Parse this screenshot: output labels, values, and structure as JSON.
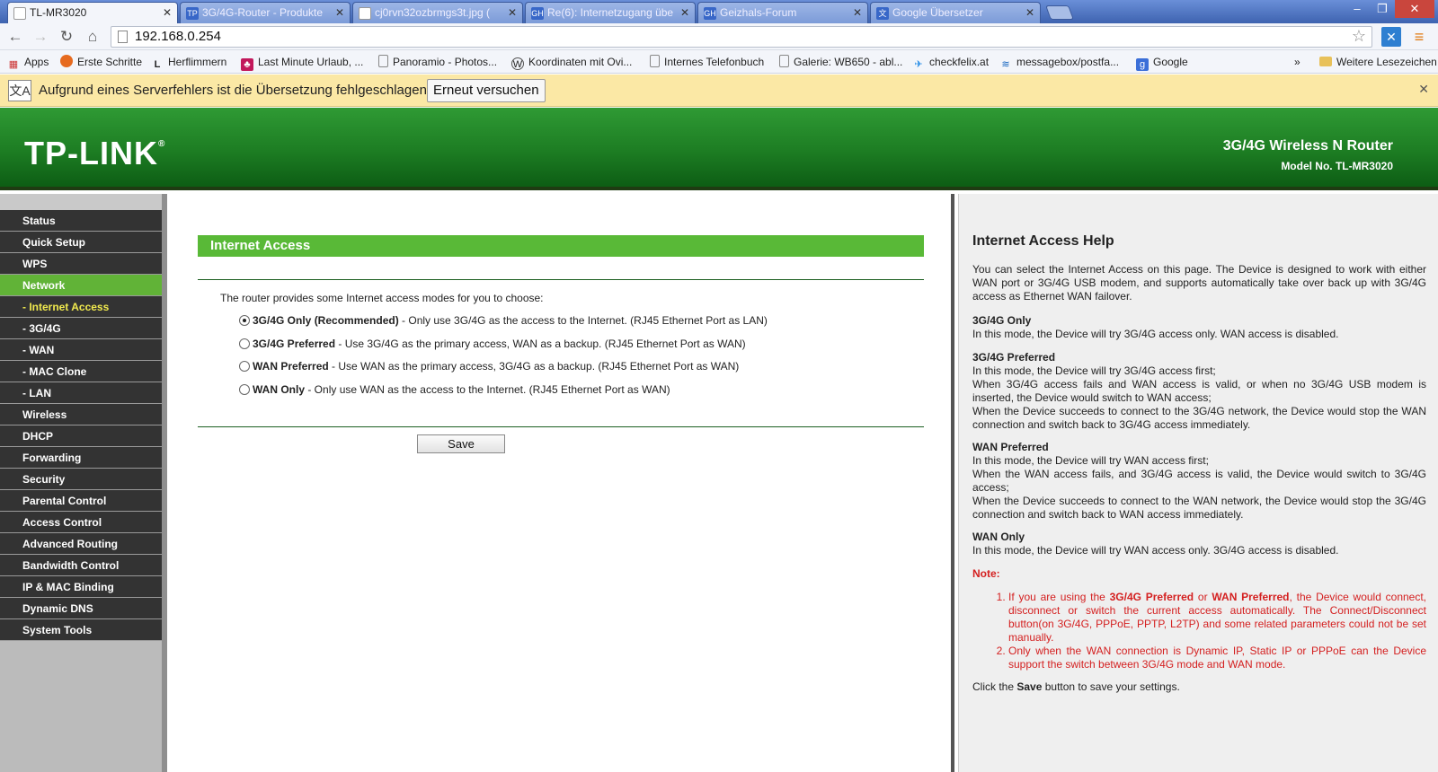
{
  "browser": {
    "tabs": [
      {
        "title": "TL-MR3020",
        "icon": "page-icon",
        "active": true
      },
      {
        "title": "3G/4G-Router - Produkte",
        "icon": "tplink-icon",
        "active": false
      },
      {
        "title": "cj0rvn32ozbrmgs3t.jpg (",
        "icon": "page-icon",
        "active": false
      },
      {
        "title": "Re(6): Internetzugang übe",
        "icon": "geizhals-icon",
        "active": false
      },
      {
        "title": "Geizhals-Forum",
        "icon": "geizhals-icon",
        "active": false
      },
      {
        "title": "Google Übersetzer",
        "icon": "translate-icon",
        "active": false
      }
    ],
    "url": "192.168.0.254",
    "bookmarks": [
      {
        "label": "Apps",
        "icon": "apps-grid-icon"
      },
      {
        "label": "Erste Schritte",
        "icon": "firefox-icon"
      },
      {
        "label": "Herflimmern",
        "icon": "l-icon"
      },
      {
        "label": "Last Minute Urlaub, ...",
        "icon": "palm-icon"
      },
      {
        "label": "Panoramio - Photos...",
        "icon": "page-icon"
      },
      {
        "label": "Koordinaten mit Ovi...",
        "icon": "wordpress-icon"
      },
      {
        "label": "Internes Telefonbuch",
        "icon": "page-icon"
      },
      {
        "label": "Galerie: WB650 - abl...",
        "icon": "page-icon"
      },
      {
        "label": "checkfelix.at",
        "icon": "plane-icon"
      },
      {
        "label": "messagebox/postfa...",
        "icon": "message-icon"
      },
      {
        "label": "Google",
        "icon": "google-icon"
      }
    ],
    "bookmarks_overflow": "»",
    "other_bookmarks": "Weitere Lesezeichen",
    "infobar": {
      "message": "Aufgrund eines Serverfehlers ist die Übersetzung fehlgeschlagen.",
      "retry_label": "Erneut versuchen"
    }
  },
  "router": {
    "logo": "TP-LINK",
    "product_name": "3G/4G Wireless N Router",
    "model_no": "Model No. TL-MR3020",
    "menu": [
      {
        "label": "Status",
        "type": "main"
      },
      {
        "label": "Quick Setup",
        "type": "main"
      },
      {
        "label": "WPS",
        "type": "main"
      },
      {
        "label": "Network",
        "type": "main",
        "active": true
      },
      {
        "label": "- Internet Access",
        "type": "sub",
        "active": true
      },
      {
        "label": "- 3G/4G",
        "type": "sub"
      },
      {
        "label": "- WAN",
        "type": "sub"
      },
      {
        "label": "- MAC Clone",
        "type": "sub"
      },
      {
        "label": "- LAN",
        "type": "sub"
      },
      {
        "label": "Wireless",
        "type": "main"
      },
      {
        "label": "DHCP",
        "type": "main"
      },
      {
        "label": "Forwarding",
        "type": "main"
      },
      {
        "label": "Security",
        "type": "main"
      },
      {
        "label": "Parental Control",
        "type": "main"
      },
      {
        "label": "Access Control",
        "type": "main"
      },
      {
        "label": "Advanced Routing",
        "type": "main"
      },
      {
        "label": "Bandwidth Control",
        "type": "main"
      },
      {
        "label": "IP & MAC Binding",
        "type": "main"
      },
      {
        "label": "Dynamic DNS",
        "type": "main"
      },
      {
        "label": "System Tools",
        "type": "main"
      }
    ],
    "section_title": "Internet Access",
    "intro": "The router provides some Internet access modes for you to choose:",
    "options": [
      {
        "name": "3G/4G Only (Recommended)",
        "desc": " - Only use 3G/4G as the access to the Internet.  (RJ45 Ethernet Port as LAN)",
        "checked": true
      },
      {
        "name": "3G/4G Preferred",
        "desc": " - Use 3G/4G as the primary access, WAN as a backup.  (RJ45 Ethernet Port as WAN)",
        "checked": false
      },
      {
        "name": "WAN Preferred",
        "desc": " - Use WAN as the primary access, 3G/4G as a backup.  (RJ45 Ethernet Port as WAN)",
        "checked": false
      },
      {
        "name": "WAN Only",
        "desc": " - Only use WAN as the access to the Internet.  (RJ45 Ethernet Port as WAN)",
        "checked": false
      }
    ],
    "save_label": "Save",
    "help": {
      "title": "Internet Access Help",
      "intro": "You can select the Internet Access on this page. The Device is designed to work with either WAN port or 3G/4G USB modem, and supports automatically take over back up with 3G/4G access as Ethernet WAN failover.",
      "only34_title": "3G/4G Only",
      "only34_text": "In this mode, the Device will try 3G/4G access only. WAN access is disabled.",
      "pref34_title": "3G/4G Preferred",
      "pref34_l1": "In this mode, the Device will try 3G/4G access first;",
      "pref34_l2": "When 3G/4G access fails and WAN access is valid, or when no 3G/4G USB modem is inserted, the Device would switch to WAN access;",
      "pref34_l3": "When the Device succeeds to connect to the 3G/4G network, the Device would stop the WAN connection and switch back to 3G/4G access immediately.",
      "prefwan_title": "WAN Preferred",
      "prefwan_l1": "In this mode, the Device will try WAN access first;",
      "prefwan_l2": "When the WAN access fails, and 3G/4G access is valid, the Device would switch to 3G/4G access;",
      "prefwan_l3": "When the Device succeeds to connect to the WAN network, the Device would stop the 3G/4G connection and switch back to WAN access immediately.",
      "onlywan_title": "WAN Only",
      "onlywan_text": "In this mode, the Device will try WAN access only. 3G/4G access is disabled.",
      "note_title": "Note:",
      "note1_a": "If you are using the ",
      "note1_b": "3G/4G Preferred",
      "note1_c": " or ",
      "note1_d": "WAN Preferred",
      "note1_e": ", the Device would connect, disconnect or switch the current access automatically. The Connect/Disconnect button(on 3G/4G, PPPoE, PPTP, L2TP) and some related parameters could not be set manually.",
      "note2": "Only when the WAN connection is Dynamic IP, Static IP or PPPoE can the Device support the switch between 3G/4G mode and WAN mode.",
      "footer_a": "Click the ",
      "footer_b": "Save",
      "footer_c": " button to save your settings."
    }
  },
  "colors": {
    "banner_green": "#1d7d23",
    "menu_active": "#61b337",
    "section_title": "#59b937",
    "note_red": "#d42020"
  }
}
